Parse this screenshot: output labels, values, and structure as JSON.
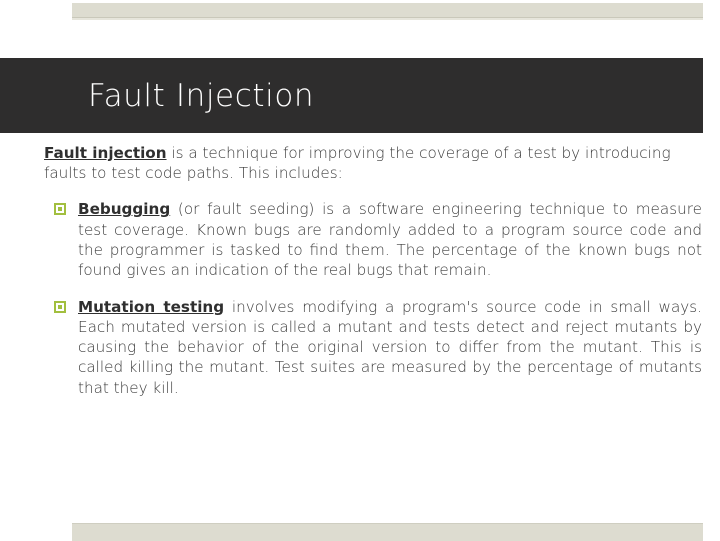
{
  "slide": {
    "title": "Fault Injection",
    "accent_green": "#a2bf3f",
    "band_color": "#2e2d2d",
    "bar_color": "#dddcd0",
    "text_color": "#3b3b3b"
  },
  "intro": {
    "lead": "Fault injection",
    "rest": " is a technique for improving the coverage of a test by introducing faults to test code paths. This includes:"
  },
  "bullets": [
    {
      "marker": "square-bullet-icon",
      "lead": "Bebugging",
      "rest": " (or fault seeding) is a software engineering technique to measure test coverage. Known bugs are randomly added to a program source code and the programmer is tasked to find them. The percentage of the known bugs not found gives an indication of the real bugs that remain."
    },
    {
      "marker": "square-bullet-icon",
      "lead": "Mutation testing",
      "rest": " involves modifying a program's source code in small ways. Each mutated version is called a mutant and tests detect and reject mutants by causing the behavior of the original version to differ from the mutant. This is called killing the mutant. Test suites are measured by the percentage of mutants that they kill."
    }
  ]
}
